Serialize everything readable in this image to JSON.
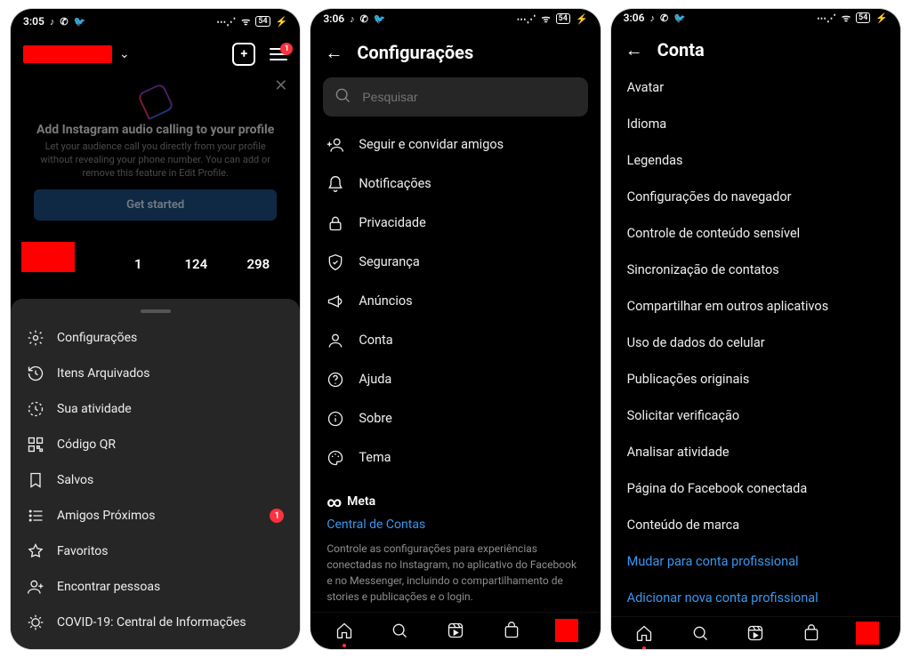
{
  "status": {
    "time1": "3:05",
    "time2": "3:06",
    "time3": "3:06",
    "battery": "54",
    "icons_left": "♪ ✆ 🐦",
    "icons_right": "⋯ ⛉"
  },
  "phone1": {
    "username_redacted": true,
    "menu_badge": "1",
    "card": {
      "title": "Add Instagram audio calling to your profile",
      "desc": "Let your audience call you directly from your profile without revealing your phone number. You can add or remove this feature in Edit Profile.",
      "cta": "Get started"
    },
    "stats": {
      "a": "1",
      "b": "124",
      "c": "298"
    },
    "sheet": [
      {
        "id": "settings",
        "label": "Configurações"
      },
      {
        "id": "archive",
        "label": "Itens Arquivados"
      },
      {
        "id": "activity",
        "label": "Sua atividade"
      },
      {
        "id": "qr",
        "label": "Código QR"
      },
      {
        "id": "saved",
        "label": "Salvos"
      },
      {
        "id": "close-friends",
        "label": "Amigos Próximos",
        "badge": "1"
      },
      {
        "id": "favorites",
        "label": "Favoritos"
      },
      {
        "id": "discover",
        "label": "Encontrar pessoas"
      },
      {
        "id": "covid",
        "label": "COVID-19: Central de Informações"
      }
    ]
  },
  "phone2": {
    "title": "Configurações",
    "search_placeholder": "Pesquisar",
    "items": [
      {
        "id": "follow-invite",
        "label": "Seguir e convidar amigos"
      },
      {
        "id": "notifications",
        "label": "Notificações"
      },
      {
        "id": "privacy",
        "label": "Privacidade"
      },
      {
        "id": "security",
        "label": "Segurança"
      },
      {
        "id": "ads",
        "label": "Anúncios"
      },
      {
        "id": "account",
        "label": "Conta"
      },
      {
        "id": "help",
        "label": "Ajuda"
      },
      {
        "id": "about",
        "label": "Sobre"
      },
      {
        "id": "theme",
        "label": "Tema"
      }
    ],
    "meta": {
      "brand": "Meta",
      "link": "Central de Contas",
      "desc": "Controle as configurações para experiências conectadas no Instagram, no aplicativo do Facebook e no Messenger, incluindo o compartilhamento de stories e publicações e o login."
    }
  },
  "phone3": {
    "title": "Conta",
    "items": [
      "Avatar",
      "Idioma",
      "Legendas",
      "Configurações do navegador",
      "Controle de conteúdo sensível",
      "Sincronização de contatos",
      "Compartilhar em outros aplicativos",
      "Uso de dados do celular",
      "Publicações originais",
      "Solicitar verificação",
      "Analisar atividade",
      "Página do Facebook conectada",
      "Conteúdo de marca"
    ],
    "links": [
      "Mudar para conta profissional",
      "Adicionar nova conta profissional"
    ]
  }
}
